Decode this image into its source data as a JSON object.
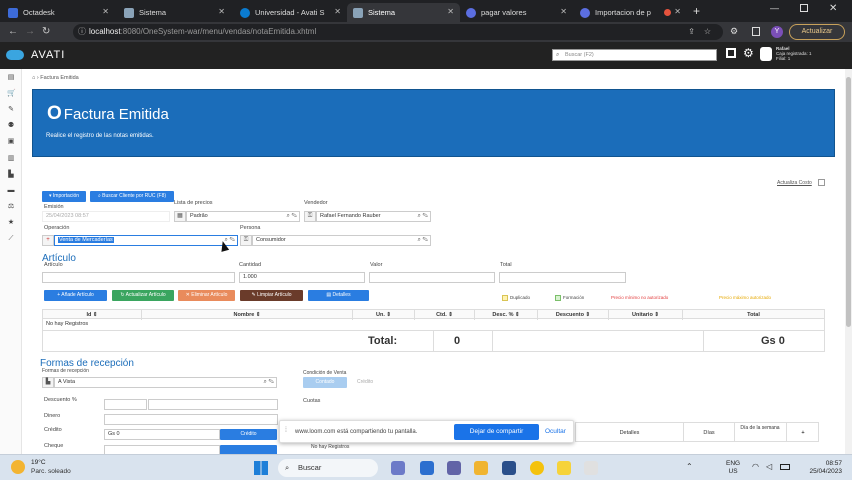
{
  "browser": {
    "tabs": [
      {
        "title": "Octadesk",
        "color": "#3d6bd8"
      },
      {
        "title": "Sistema",
        "color": "#8aa3b8"
      },
      {
        "title": "Universidad - Avati S",
        "color": "#0a7bd0"
      },
      {
        "title": "Sistema",
        "color": "#8aa3b8"
      },
      {
        "title": "pagar valores",
        "color": "#5b6ee1"
      },
      {
        "title": "Importacion de p",
        "color": "#5b6ee1"
      }
    ],
    "url_host": "localhost",
    "url_path": ":8080/OneSystem-war/menu/vendas/notaEmitida.xhtml",
    "update_label": "Actualizar",
    "avatar_initial": "Y"
  },
  "app": {
    "logo": "AVATI",
    "search_placeholder": "Buscar (F2)",
    "user_line1": "Rafael",
    "user_line2": "Caja registrada: 1",
    "user_line3": "Filial: 1"
  },
  "breadcrumb": "Factura Emitida",
  "banner": {
    "title": "Factura Emitida",
    "subtitle": "Realice el registro de las notas emitidas."
  },
  "form": {
    "actualiza_costo": "Actualiza Costo",
    "btn_importacion": "Importación",
    "btn_buscar_cliente": "Buscar Cliente por RUC (F8)",
    "emision_label": "Emisión",
    "emision_value": "25/04/2023 08:57",
    "lista_precios_label": "Lista de precios",
    "lista_precios_value": "Padrão",
    "vendedor_label": "Vendedor",
    "vendedor_value": "Rafael Fernando Rauber",
    "operacion_label": "Operación",
    "operacion_value": "Venta de Mercaderías",
    "persona_label": "Persona",
    "persona_value": "Consumidor",
    "articulo_section": "Artículo",
    "articulo_label": "Artículo",
    "cantidad_label": "Cantidad",
    "cantidad_value": "1.000",
    "valor_label": "Valor",
    "total_label": "Total",
    "btn_anade": "Añade Artículo",
    "btn_actualizar": "Actualizar Artículo",
    "btn_eliminar": "Eliminar Artículo",
    "btn_limpiar": "Limpiar Artículo",
    "btn_detalles": "Detalles",
    "legend_duplicado": "Duplicado",
    "legend_formacion": "Formación",
    "legend_precio_minimo": "Precio mínimo no autorizado",
    "legend_precio_maximo": "Precio máximo autorizado"
  },
  "table": {
    "headers": [
      "Id",
      "Nombre",
      "Un.",
      "Ctd.",
      "Desc. %",
      "Descuento",
      "Unitario",
      "Total"
    ],
    "empty": "No hay Registros",
    "total_label": "Total:",
    "total_qty": "0",
    "total_value": "Gs 0"
  },
  "formas": {
    "section": "Formas de recepción",
    "formas_label": "Formas de recepción",
    "formas_value": "A Vista",
    "condicion_label": "Condición de Venta",
    "contado": "Contado",
    "credito_opt": "Crédito",
    "descuento_label": "Descuento %",
    "dinero_label": "Dinero",
    "credito_label": "Crédito",
    "credito_value": "Gs 0",
    "credito_btn": "Crédito",
    "cheque_label": "Cheque",
    "cuotas_label": "Cuotas",
    "cuotas_headers": [
      "Detalles",
      "Días",
      "Día de la semana",
      "+"
    ],
    "cuotas_empty": "No hay Registros"
  },
  "toast": {
    "text": "www.loom.com está compartiendo tu pantalla.",
    "stop": "Dejar de compartir",
    "hide": "Ocultar"
  },
  "taskbar": {
    "temp": "19°C",
    "weather": "Parc. soleado",
    "search": "Buscar",
    "lang1": "ENG",
    "lang2": "US",
    "time": "08:57",
    "date": "25/04/2023"
  }
}
